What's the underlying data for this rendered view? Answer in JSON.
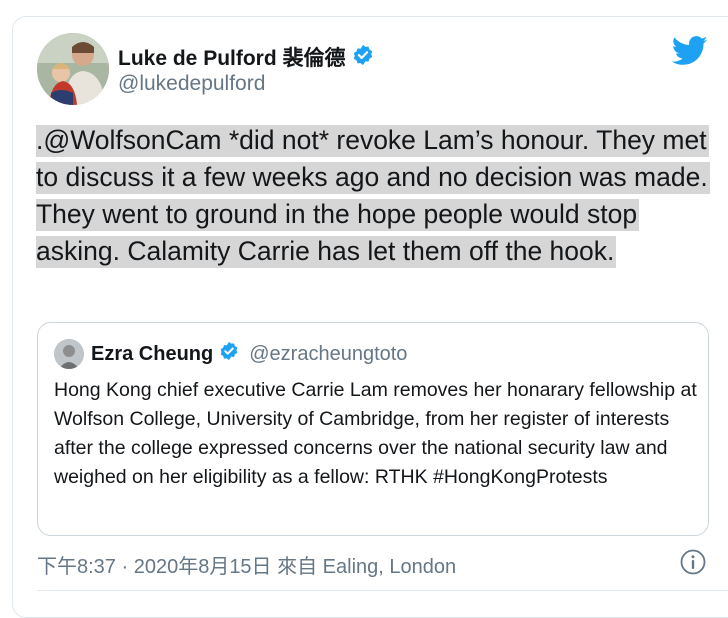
{
  "tweet": {
    "author_name": "Luke de Pulford 裴倫德",
    "author_handle": "@lukedepulford",
    "text": ".@WolfsonCam *did not* revoke Lam’s honour. They met to discuss it a few weeks ago and no decision was made. They went to ground in the hope people would stop asking. Calamity Carrie has let them off the hook.",
    "meta": "下午8:37 · 2020年8月15日 來自 Ealing, London"
  },
  "quoted": {
    "author_name": "Ezra Cheung",
    "author_handle": "@ezracheungtoto",
    "text": "Hong Kong chief executive Carrie Lam removes her honarary fellowship at Wolfson College, University of Cambridge, from her register of interests after the college expressed concerns over the national security law and weighed on her eligibility as a fellow: RTHK #HongKongProtests"
  },
  "colors": {
    "twitter_blue": "#1da1f2",
    "secondary_text": "#657786",
    "highlight": "#d6d6d6"
  },
  "icons": [
    "verified-badge-icon",
    "twitter-bird-icon",
    "info-icon"
  ]
}
